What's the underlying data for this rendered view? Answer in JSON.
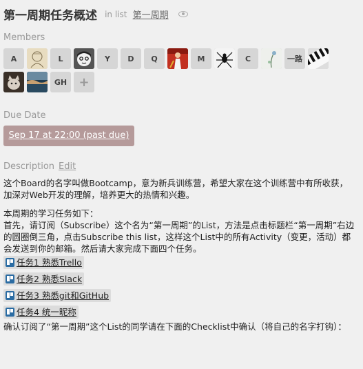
{
  "card": {
    "title": "第一周期任务概述",
    "in_list_prefix": "in list",
    "list_name": "第一周期"
  },
  "members": {
    "label": "Members",
    "avatars": [
      {
        "kind": "initial",
        "text": "A"
      },
      {
        "kind": "image",
        "icon": "sketch-avatar-image"
      },
      {
        "kind": "initial",
        "text": "L"
      },
      {
        "kind": "image",
        "icon": "cartoon-face-avatar-image"
      },
      {
        "kind": "initial",
        "text": "Y"
      },
      {
        "kind": "initial",
        "text": "D"
      },
      {
        "kind": "initial",
        "text": "Q"
      },
      {
        "kind": "image",
        "icon": "red-figure-avatar-image"
      },
      {
        "kind": "initial",
        "text": "M"
      },
      {
        "kind": "image",
        "icon": "spider-avatar-image"
      },
      {
        "kind": "initial",
        "text": "C"
      },
      {
        "kind": "image",
        "icon": "flower-avatar-image"
      },
      {
        "kind": "initial",
        "text": "一路"
      },
      {
        "kind": "image",
        "icon": "piano-keys-avatar-image"
      },
      {
        "kind": "image",
        "icon": "cat-avatar-image"
      },
      {
        "kind": "image",
        "icon": "landscape-avatar-image"
      },
      {
        "kind": "initial",
        "text": "GH"
      },
      {
        "kind": "add",
        "text": "+"
      }
    ]
  },
  "due": {
    "label": "Due Date",
    "value": "Sep 17 at 22:00 (past due)",
    "color": "#b59a9a"
  },
  "description": {
    "label": "Description",
    "edit": "Edit",
    "para1": "这个Board的名字叫做Bootcamp，意为新兵训练营，希望大家在这个训练营中有所收获，加深对Web开发的理解，培养更大的热情和兴趣。",
    "para2_head": "本周期的学习任务如下：",
    "para2_body": "首先，请订阅（Subscribe）这个名为“第一周期”的List，方法是点击标题栏“第一周期”右边的圆圈倒三角，点击Subscribe this list，这样这个List中的所有Activity（变更，活动）都会发送到你的邮箱。然后请大家完成下面四个任务。",
    "tasks": [
      "任务1 熟悉Trello",
      "任务2 熟悉Slack",
      "任务3 熟悉git和GitHub",
      "任务4 统一昵称"
    ],
    "para3": "确认订阅了“第一周期”这个List的同学请在下面的Checklist中确认（将自己的名字打钩）："
  }
}
